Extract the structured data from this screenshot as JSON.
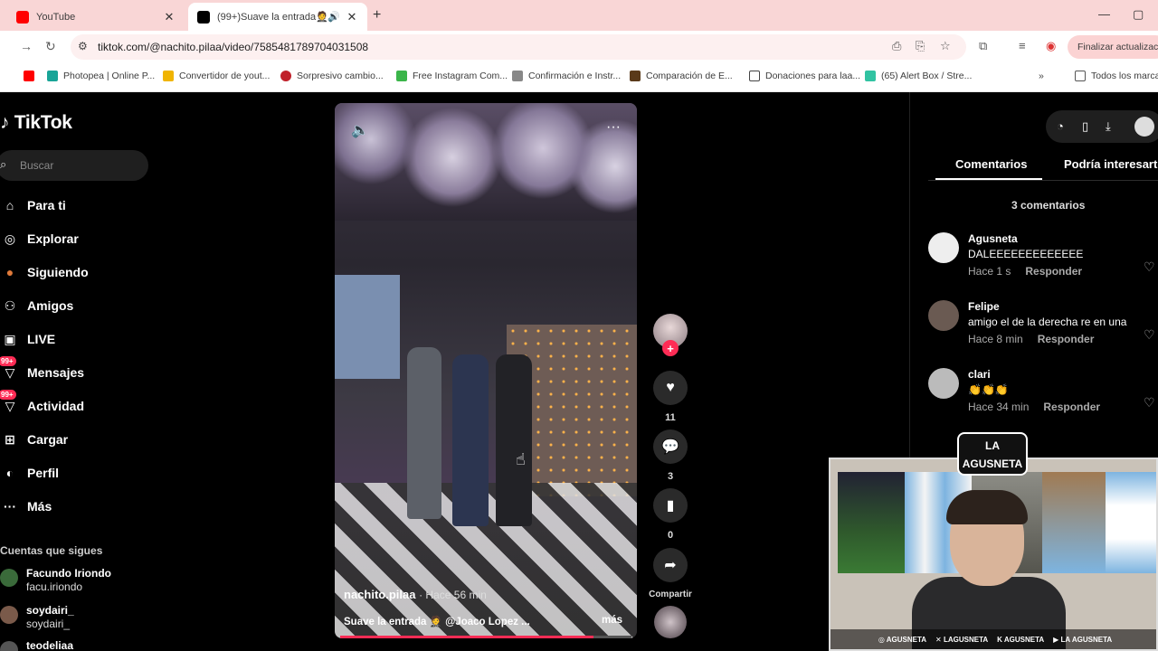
{
  "browser": {
    "tabs": [
      {
        "title": "YouTube",
        "active": false
      },
      {
        "title": "(99+)Suave la entrada🤵@",
        "active": true
      }
    ],
    "url": "tiktok.com/@nachito.pilaa/video/7585481789704031508",
    "update_label": "Finalizar actualizació",
    "bookmarks": [
      {
        "label": "Photopea | Online P..."
      },
      {
        "label": "Convertidor de yout..."
      },
      {
        "label": "Sorpresivo cambio..."
      },
      {
        "label": "Free Instagram Com..."
      },
      {
        "label": "Confirmación e Instr..."
      },
      {
        "label": "Comparación de E..."
      },
      {
        "label": "Donaciones para laa..."
      },
      {
        "label": "(65) Alert Box / Stre..."
      }
    ],
    "all_bookmarks": "Todos los marca",
    "overflow": "»",
    "colors": {
      "tabstrip": "#f9d6d6",
      "youtube_red": "#ff0000"
    }
  },
  "tiktok": {
    "logo": "TikTok",
    "search_placeholder": "Buscar",
    "nav": [
      {
        "label": "Para ti",
        "icon": "home-icon"
      },
      {
        "label": "Explorar",
        "icon": "compass-icon"
      },
      {
        "label": "Siguiendo",
        "icon": "following-icon"
      },
      {
        "label": "Amigos",
        "icon": "friends-icon"
      },
      {
        "label": "LIVE",
        "icon": "live-icon"
      },
      {
        "label": "Mensajes",
        "icon": "messages-icon",
        "badge": "99+"
      },
      {
        "label": "Actividad",
        "icon": "activity-icon",
        "badge": "99+"
      },
      {
        "label": "Cargar",
        "icon": "upload-icon"
      },
      {
        "label": "Perfil",
        "icon": "profile-icon"
      },
      {
        "label": "Más",
        "icon": "more-icon"
      }
    ],
    "following_title": "Cuentas que sigues",
    "following": [
      {
        "name": "Facundo Iriondo",
        "handle": "facu.iriondo"
      },
      {
        "name": "soydairi_",
        "handle": "soydairi_"
      },
      {
        "name": "teodeliaa",
        "handle": ""
      }
    ],
    "video": {
      "author": "nachito.pilaa",
      "time": "· Hace 56 min",
      "description": "Suave la entrada 🤵 @Joaco Lopez ...",
      "more": "más",
      "progress_fraction": 0.87
    },
    "actions": {
      "likes": "11",
      "comments": "3",
      "saves": "0",
      "share_label": "Compartir"
    },
    "panel": {
      "tab_comments": "Comentarios",
      "tab_related": "Podría interesarte",
      "comments_count": "3 comentarios",
      "reply_label": "Responder",
      "comments": [
        {
          "user": "Agusneta",
          "text": "DALEEEEEEEEEEEEE",
          "time": "Hace 1 s"
        },
        {
          "user": "Felipe",
          "text": "amigo el de la derecha re en una",
          "time": "Hace 8 min"
        },
        {
          "user": "clari",
          "text": "👏👏👏",
          "time": "Hace 34 min"
        }
      ]
    },
    "colors": {
      "accent": "#fe2c55",
      "background": "#000000"
    }
  },
  "webcam": {
    "logo_line1": "LA",
    "logo_line2": "AGUSNETA",
    "social": [
      "AGUSNETA",
      "LAGUSNETA",
      "AGUSNETA",
      "LA AGUSNETA"
    ]
  }
}
